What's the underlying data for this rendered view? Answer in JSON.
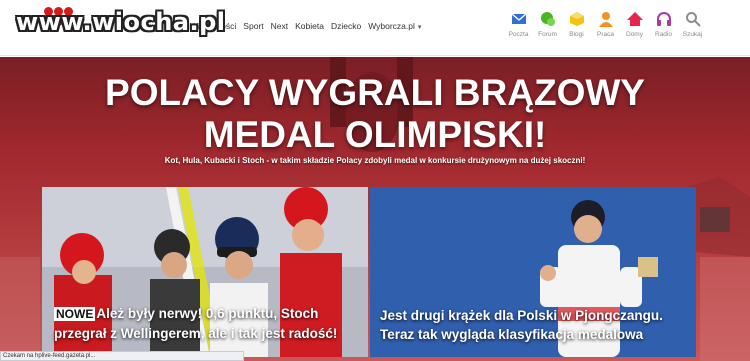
{
  "watermark": "www.wiocha.pl",
  "nav": {
    "items": [
      "Wiadomości",
      "Sport",
      "Next",
      "Kobieta",
      "Dziecko",
      "Wyborcza.pl"
    ],
    "dropdown_caret": "▾"
  },
  "services": [
    {
      "label": "Poczta",
      "icon": "mail-icon",
      "color": "#2f6fd6"
    },
    {
      "label": "Forum",
      "icon": "forum-icon",
      "color": "#49b520"
    },
    {
      "label": "Blogi",
      "icon": "blog-icon",
      "color": "#f1c40f"
    },
    {
      "label": "Praca",
      "icon": "job-icon",
      "color": "#f39122"
    },
    {
      "label": "Domy",
      "icon": "house-icon",
      "color": "#e8264d"
    },
    {
      "label": "Radio",
      "icon": "headphones-icon",
      "color": "#a53aa8"
    },
    {
      "label": "Szukaj",
      "icon": "search-icon",
      "color": "#8d8d8d"
    }
  ],
  "hero": {
    "headline_line1": "POLACY WYGRALI BRĄZOWY",
    "headline_line2": "MEDAL OLIMPISKI!",
    "lead": "Kot, Hula, Kubacki i Stoch - w takim składzie Polacy zdobyli medal w konkursie drużynowym na dużej skoczni!"
  },
  "cards": [
    {
      "badge": "NOWE",
      "title_line1": "Ależ były nerwy! 0,6 punktu, Stoch",
      "title_line2": "przegrał z Wellingerem, ale i tak jest radość!"
    },
    {
      "title_line1": "Jest drugi krążek dla Polski w Pjongczangu.",
      "title_line2": "Teraz tak wygląda klasyfikacja medalowa"
    }
  ],
  "status_bar": "Czekam na hplive-feed.gazeta.pl..."
}
